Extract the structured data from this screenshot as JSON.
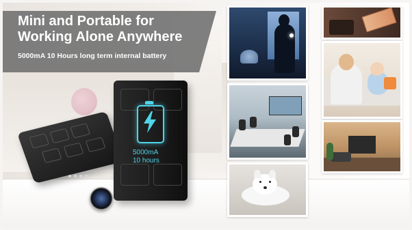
{
  "banner": {
    "headline_line1": "Mini and Portable for",
    "headline_line2": "Working Alone Anywhere",
    "subline": "5000mA 10 Hours long term internal battery"
  },
  "device": {
    "battery_capacity": "5000mA",
    "battery_hours": "10 hours",
    "accent_color": "#4fd4e8"
  },
  "colors": {
    "banner_bg": "#6e6e6e",
    "device_body": "#1b1b1b"
  },
  "photos": [
    {
      "name": "night-intruder-photo"
    },
    {
      "name": "office-meeting-photo"
    },
    {
      "name": "dog-photo"
    },
    {
      "name": "cash-wallet-photo"
    },
    {
      "name": "mother-baby-photo"
    },
    {
      "name": "living-room-photo"
    }
  ]
}
